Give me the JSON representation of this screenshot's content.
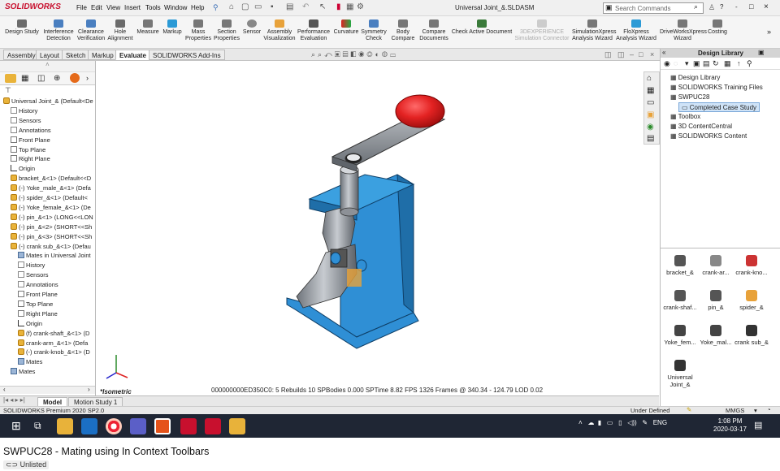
{
  "app": {
    "logo_text": "SOLIDWORKS",
    "menu": [
      "File",
      "Edit",
      "View",
      "Insert",
      "Tools",
      "Window",
      "Help"
    ],
    "document_title": "Universal Joint_&.SLDASM",
    "search_placeholder": "Search Commands",
    "window_controls": [
      "?",
      "-",
      "□",
      "×"
    ]
  },
  "ribbon": {
    "buttons": [
      "Design Study",
      "Interference Detection",
      "Clearance Verification",
      "Hole Alignment",
      "Measure",
      "Markup",
      "Mass Properties",
      "Section Properties",
      "Sensor",
      "Assembly Visualization",
      "Performance Evaluation",
      "Curvature",
      "Symmetry Check",
      "Body Compare",
      "Compare Documents",
      "Check Active Document",
      "3DEXPERIENCE Simulation Connector",
      "SimulationXpress Analysis Wizard",
      "FloXpress Analysis Wizard",
      "DriveWorksXpress Wizard",
      "Costing"
    ]
  },
  "command_tabs": [
    "Assembly",
    "Layout",
    "Sketch",
    "Markup",
    "Evaluate",
    "SOLIDWORKS Add-Ins"
  ],
  "active_command_tab": "Evaluate",
  "feature_tree": [
    {
      "label": "Universal Joint_& (Default<De",
      "icon": "assembly",
      "indent": 0
    },
    {
      "label": "History",
      "icon": "folder",
      "indent": 1
    },
    {
      "label": "Sensors",
      "icon": "folder",
      "indent": 1
    },
    {
      "label": "Annotations",
      "icon": "folder",
      "indent": 1
    },
    {
      "label": "Front Plane",
      "icon": "plane",
      "indent": 1
    },
    {
      "label": "Top Plane",
      "icon": "plane",
      "indent": 1
    },
    {
      "label": "Right Plane",
      "icon": "plane",
      "indent": 1
    },
    {
      "label": "Origin",
      "icon": "origin",
      "indent": 1
    },
    {
      "label": "bracket_&<1> (Default<<D",
      "icon": "part",
      "indent": 1
    },
    {
      "label": "(-) Yoke_male_&<1> (Defa",
      "icon": "part",
      "indent": 1
    },
    {
      "label": "(-) spider_&<1> (Default<",
      "icon": "part",
      "indent": 1
    },
    {
      "label": "(-) Yoke_female_&<1> (De",
      "icon": "part",
      "indent": 1
    },
    {
      "label": "(-) pin_&<1> (LONG<<LON",
      "icon": "part",
      "indent": 1
    },
    {
      "label": "(-) pin_&<2> (SHORT<<Sh",
      "icon": "part",
      "indent": 1
    },
    {
      "label": "(-) pin_&<3> (SHORT<<Sh",
      "icon": "part",
      "indent": 1
    },
    {
      "label": "(-) crank sub_&<1> (Defau",
      "icon": "part",
      "indent": 1
    },
    {
      "label": "Mates in Universal Joint",
      "icon": "mate",
      "indent": 2
    },
    {
      "label": "History",
      "icon": "folder",
      "indent": 2
    },
    {
      "label": "Sensors",
      "icon": "folder",
      "indent": 2
    },
    {
      "label": "Annotations",
      "icon": "folder",
      "indent": 2
    },
    {
      "label": "Front Plane",
      "icon": "plane",
      "indent": 2
    },
    {
      "label": "Top Plane",
      "icon": "plane",
      "indent": 2
    },
    {
      "label": "Right Plane",
      "icon": "plane",
      "indent": 2
    },
    {
      "label": "Origin",
      "icon": "origin",
      "indent": 2
    },
    {
      "label": "(f) crank-shaft_&<1> (D",
      "icon": "part",
      "indent": 2
    },
    {
      "label": "crank-arm_&<1> (Defa",
      "icon": "part",
      "indent": 2
    },
    {
      "label": "(-) crank-knob_&<1> (D",
      "icon": "part",
      "indent": 2
    },
    {
      "label": "Mates",
      "icon": "mate",
      "indent": 2
    },
    {
      "label": "Mates",
      "icon": "mate",
      "indent": 1
    }
  ],
  "viewport": {
    "orientation_label": "*Isometric",
    "stats": "000000000ED350C0:     5 Rebuilds     10 SPBodies  0.000 SPTime   8.82 FPS    1326 Frames @ 340.34 - 124.79 LOD 0.02"
  },
  "design_library": {
    "title": "Design Library",
    "tree": [
      {
        "label": "Design Library",
        "selected": false,
        "indent": 1
      },
      {
        "label": "SOLIDWORKS Training Files",
        "selected": false,
        "indent": 1
      },
      {
        "label": "SWPUC28",
        "selected": false,
        "indent": 1
      },
      {
        "label": "Completed Case Study",
        "selected": true,
        "indent": 2
      },
      {
        "label": "Toolbox",
        "selected": false,
        "indent": 1
      },
      {
        "label": "3D ContentCentral",
        "selected": false,
        "indent": 1
      },
      {
        "label": "SOLIDWORKS Content",
        "selected": false,
        "indent": 1
      }
    ],
    "items": [
      "bracket_&",
      "crank-ar...",
      "crank-kno...",
      "crank-shaf...",
      "pin_&",
      "spider_&",
      "Yoke_fem...",
      "Yoke_mal...",
      "crank sub_&",
      "Universal Joint_&"
    ]
  },
  "bottom_tabs": [
    "Model",
    "Motion Study 1"
  ],
  "active_bottom_tab": "Model",
  "status": {
    "left": "SOLIDWORKS Premium 2020 SP2.0",
    "state": "Under Defined",
    "units": "MMGS"
  },
  "taskbar": {
    "language": "ENG",
    "time": "1:08 PM",
    "date": "2020-03-17"
  },
  "video": {
    "title": "SWPUC28 - Mating using In Context Toolbars",
    "visibility": "Unlisted"
  },
  "colors": {
    "bracket_blue": "#2f8fd5",
    "metal_gray": "#8a8f96",
    "knob_red": "#e32222",
    "brand_red": "#c8102e"
  }
}
